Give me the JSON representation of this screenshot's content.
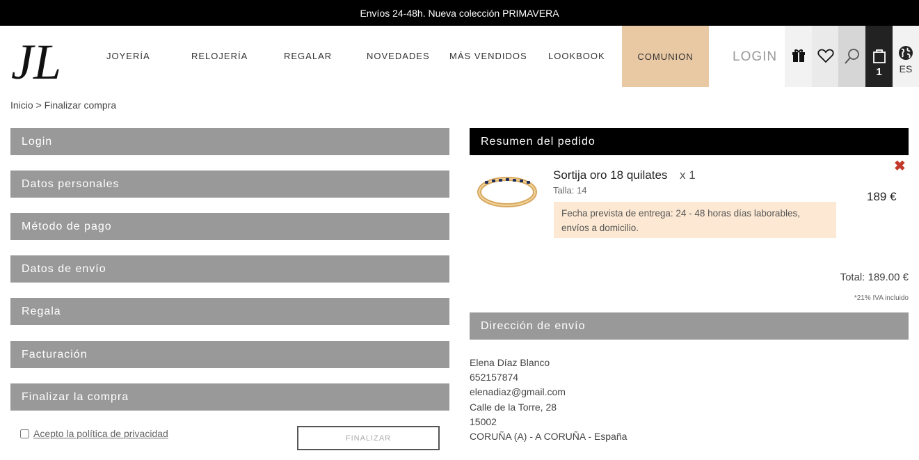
{
  "topbar": {
    "text": "Envíos 24-48h. Nueva colección  PRIMAVERA"
  },
  "header": {
    "logo_text": "JL",
    "nav": [
      "JOYERÍA",
      "RELOJERÍA",
      "REGALAR",
      "NOVEDADES",
      "MÁS VENDIDOS",
      "LOOKBOOK"
    ],
    "comunion": "COMUNION",
    "login": "LOGIN",
    "cart_count": "1",
    "lang": "ES",
    "icons": [
      "gift-icon",
      "heart-icon",
      "search-icon",
      "bag-icon",
      "globe-icon"
    ]
  },
  "breadcrumb": {
    "home": "Inicio",
    "separator": ">",
    "current": "Finalizar compra"
  },
  "steps": [
    "Login",
    "Datos personales",
    "Método de pago",
    "Datos de envío",
    "Regala",
    "Facturación",
    "Finalizar la compra"
  ],
  "privacy": {
    "label": "Acepto la política de privacidad",
    "checked": false
  },
  "finalize_button": "FINALIZAR",
  "summary": {
    "title": "Resumen del pedido",
    "product": {
      "name": "Sortija oro 18 quilates",
      "qty": "x 1",
      "size": "Talla: 14",
      "price": "189 €",
      "remove": "✖",
      "delivery": "Fecha prevista de entrega: 24 - 48 horas días laborables, envíos a domicilio."
    },
    "total": "Total: 189.00 €",
    "iva": "*21% IVA incluido"
  },
  "shipping": {
    "title": "Dirección de envío",
    "lines": [
      "Elena Díaz Blanco",
      "652157874",
      "elenadiaz@gmail.com",
      "Calle de la Torre, 28",
      "15002",
      "CORUÑA (A) - A CORUÑA - España"
    ]
  },
  "colors": {
    "accent": "#e9c8a4",
    "step_bg": "#999999",
    "delivery_bg": "#fde9d3",
    "remove": "#c0392b"
  }
}
